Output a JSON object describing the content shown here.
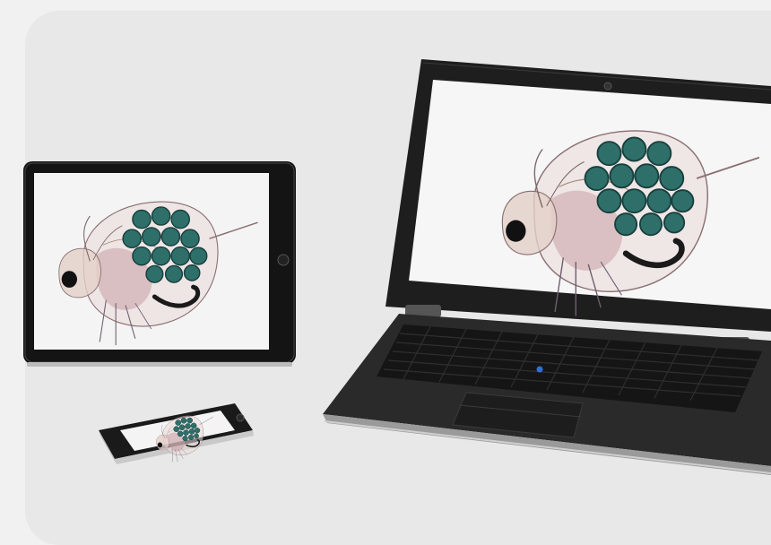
{
  "scene": {
    "background_color": "#f1f1f1",
    "card_color": "#e8e8e8",
    "devices": [
      {
        "kind": "tablet",
        "icon": "tablet-icon",
        "bezel_color": "#151515"
      },
      {
        "kind": "laptop",
        "icon": "laptop-icon",
        "bezel_color": "#1c1c1c"
      },
      {
        "kind": "phone",
        "icon": "phone-icon",
        "bezel_color": "#1a1a1a"
      }
    ],
    "screen_subject": {
      "icon": "water-flea-icon",
      "egg_color": "#2e6f6a",
      "body_color": "#c9a9a9"
    }
  }
}
